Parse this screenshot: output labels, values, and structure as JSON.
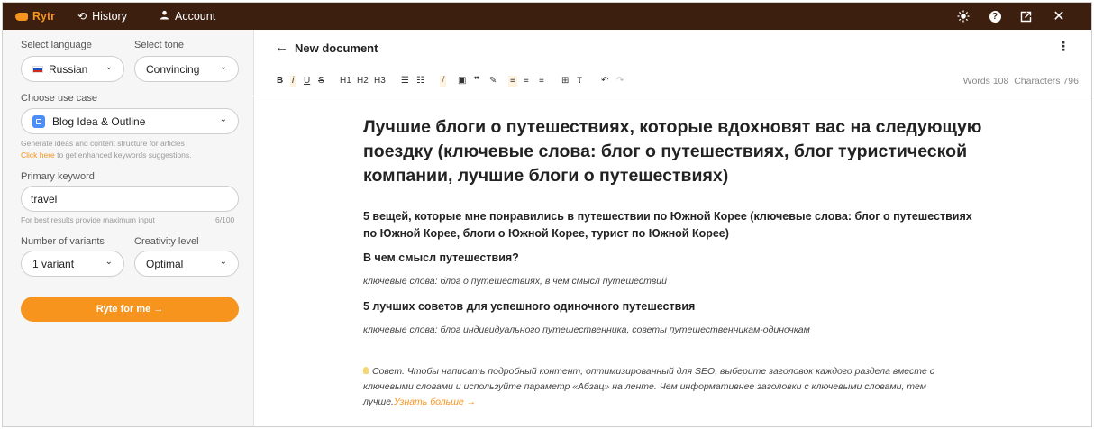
{
  "topbar": {
    "logo": "Rytr",
    "history": "History",
    "account": "Account"
  },
  "sidebar": {
    "language_label": "Select language",
    "language_value": "Russian",
    "tone_label": "Select tone",
    "tone_value": "Convincing",
    "usecase_label": "Choose use case",
    "usecase_value": "Blog Idea & Outline",
    "usecase_hint": "Generate ideas and content structure for articles",
    "click_here": "Click here",
    "keywords_hint": " to get enhanced keywords suggestions.",
    "keyword_label": "Primary keyword",
    "keyword_value": "travel",
    "keyword_hint": "For best results provide maximum input",
    "keyword_count": "6/100",
    "variants_label": "Number of variants",
    "variants_value": "1 variant",
    "creativity_label": "Creativity level",
    "creativity_value": "Optimal",
    "ryte_button": "Ryte for me →"
  },
  "editor": {
    "title": "New document",
    "toolbar": [
      "B",
      "i",
      "U",
      "S",
      "H1",
      "H2",
      "H3"
    ],
    "words": "Words 108",
    "characters": "Characters 796"
  },
  "document": {
    "h1": "Лучшие блоги о путешествиях, которые вдохновят вас на следующую поездку (ключевые слова: блог о путешествиях, блог туристической компании, лучшие блоги о путешествиях)",
    "h2": "5 вещей, которые мне понравились в путешествии по Южной Корее (ключевые слова: блог о путешествиях по Южной Корее, блоги о Южной Корее, турист по Южной Корее)",
    "h3_1": "В чем смысл путешествия?",
    "kw_1": "ключевые слова: блог о путешествиях, в чем смысл путешествий",
    "h3_2": "5 лучших советов для успешного одиночного путешествия",
    "kw_2": "ключевые слова: блог индивидуального путешественника, советы путешественникам-одиночкам",
    "tip_text": "Совет. Чтобы написать подробный контент, оптимизированный для SEO, выберите заголовок каждого раздела вместе с ключевыми словами и используйте параметр «Абзац» на ленте. Чем информативнее заголовки с ключевыми словами, тем лучше.",
    "tip_more": "Узнать больше →"
  }
}
